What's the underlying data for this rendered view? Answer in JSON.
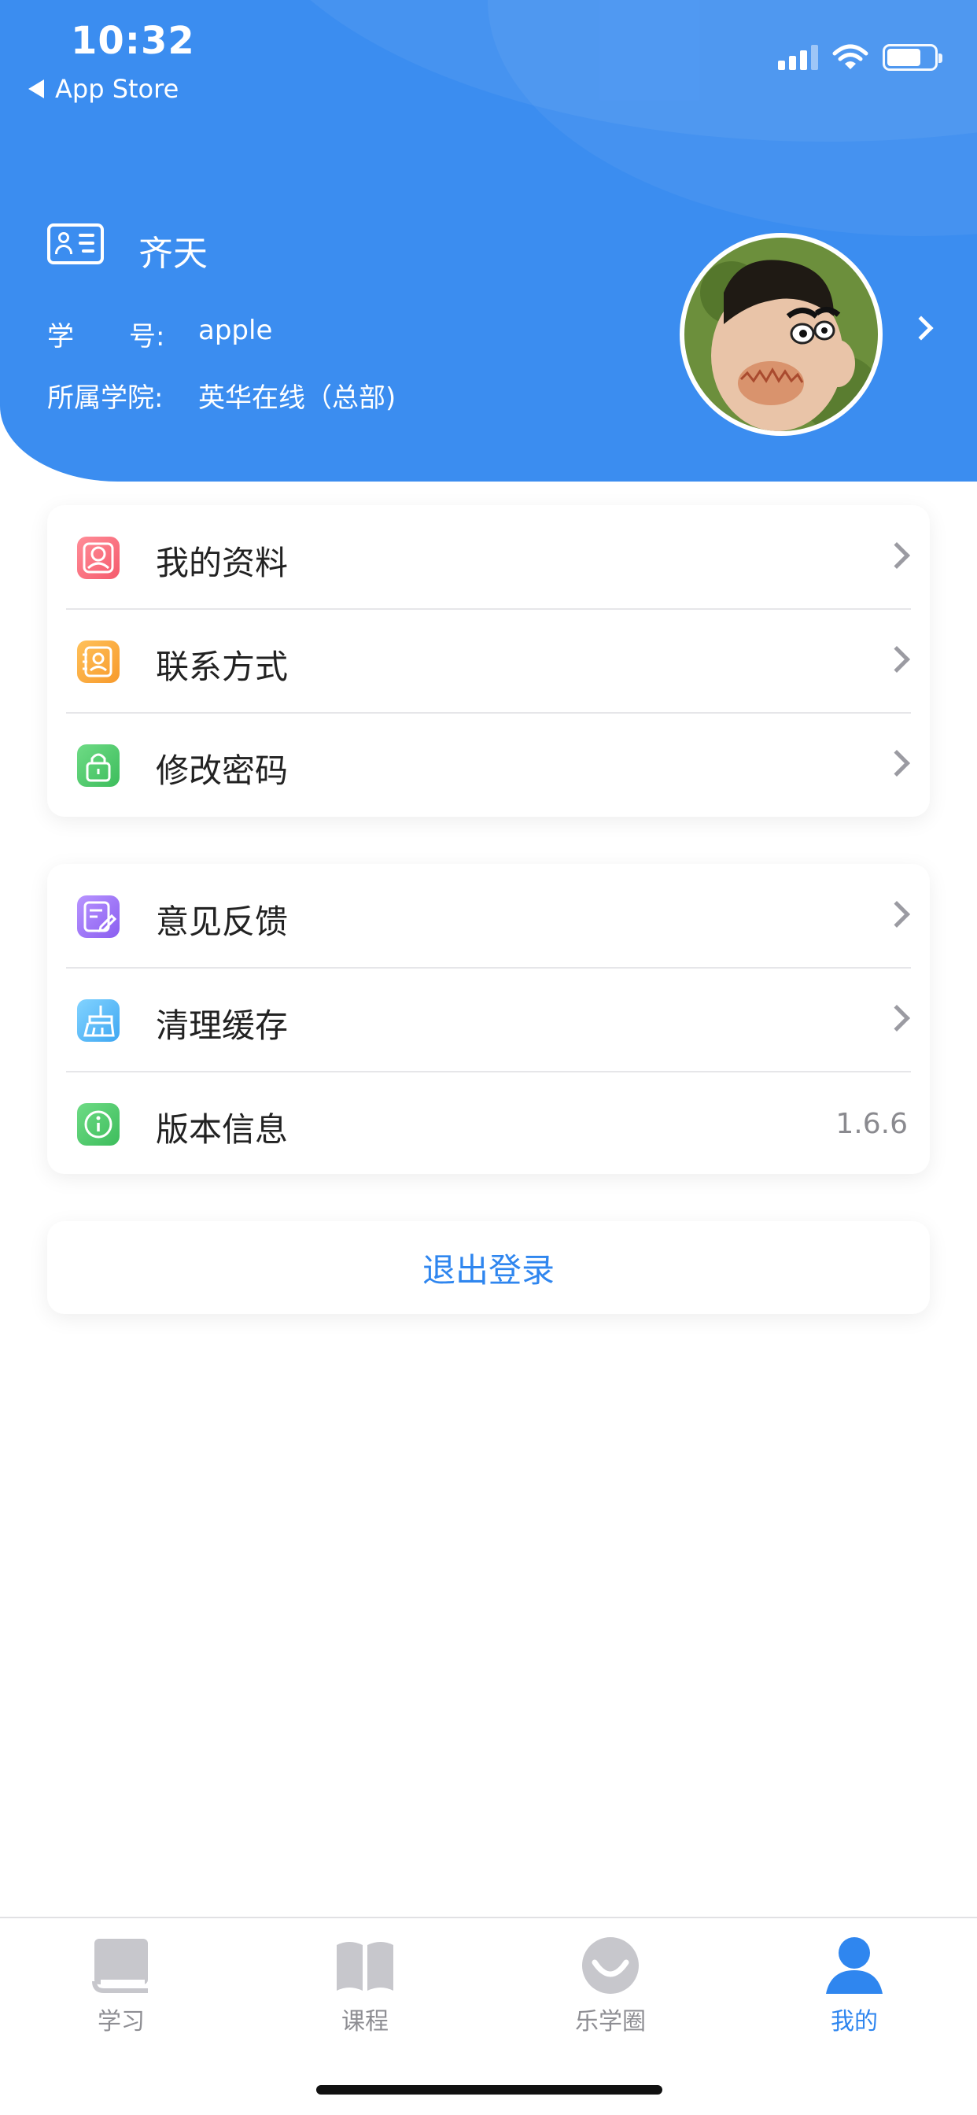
{
  "status_bar": {
    "time": "10:32",
    "back_label": "App Store"
  },
  "profile": {
    "name": "齐天",
    "student_id_label_a": "学",
    "student_id_label_b": "号:",
    "student_id": "apple",
    "college_label": "所属学院:",
    "college": "英华在线（总部)"
  },
  "menu_group_1": [
    {
      "label": "我的资料",
      "icon": "profile-icon",
      "color": "#f56a7a"
    },
    {
      "label": "联系方式",
      "icon": "contact-icon",
      "color": "#f8a73a"
    },
    {
      "label": "修改密码",
      "icon": "lock-icon",
      "color": "#45c867"
    }
  ],
  "menu_group_2": [
    {
      "label": "意见反馈",
      "icon": "feedback-icon",
      "color": "#9a6ff0"
    },
    {
      "label": "清理缓存",
      "icon": "broom-icon",
      "color": "#4ab3f5"
    },
    {
      "label": "版本信息",
      "icon": "info-icon",
      "color": "#45c867",
      "value": "1.6.6"
    }
  ],
  "logout_label": "退出登录",
  "tabs": [
    {
      "label": "学习",
      "icon": "book-icon"
    },
    {
      "label": "课程",
      "icon": "open-book-icon"
    },
    {
      "label": "乐学圈",
      "icon": "smile-circle-icon"
    },
    {
      "label": "我的",
      "icon": "person-icon"
    }
  ],
  "colors": {
    "header_blue": "#3b8df0",
    "accent_blue": "#2f86ef",
    "tab_inactive": "#c7c7cc"
  }
}
